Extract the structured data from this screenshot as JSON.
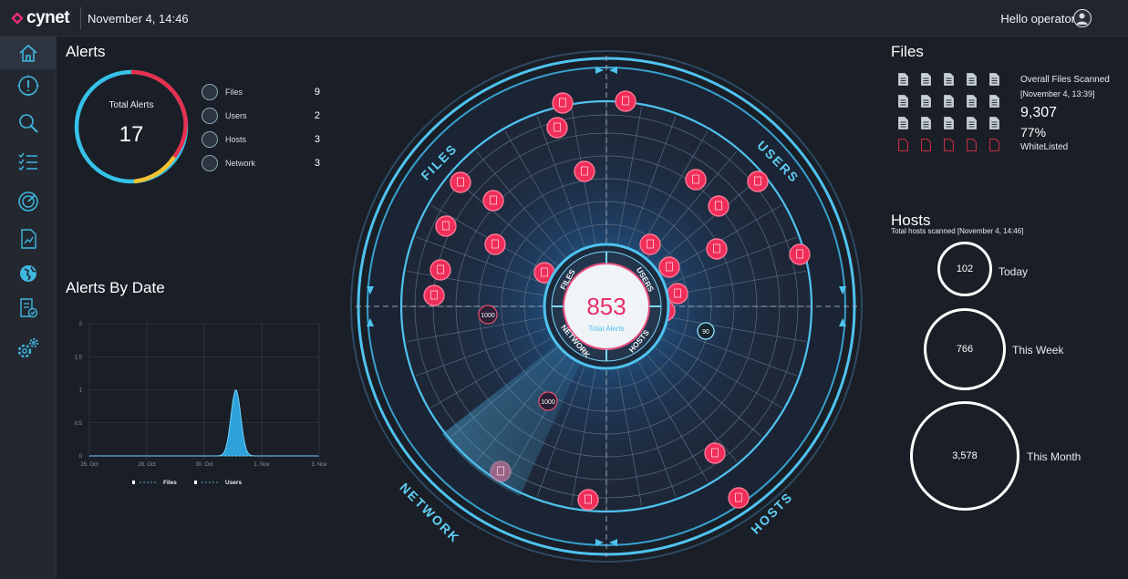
{
  "app": {
    "logo_text": "cynet",
    "date": "November 4, 14:46",
    "greeting": "Hello operator"
  },
  "sidebar": {
    "items": [
      {
        "icon": "home-icon",
        "active": true
      },
      {
        "icon": "alert-compass-icon"
      },
      {
        "icon": "search-icon"
      },
      {
        "icon": "checklist-icon"
      },
      {
        "icon": "radar-icon"
      },
      {
        "icon": "report-icon"
      },
      {
        "icon": "globe-icon"
      },
      {
        "icon": "policy-icon"
      },
      {
        "icon": "settings-icon"
      }
    ]
  },
  "alerts": {
    "title": "Alerts",
    "total_label": "Total Alerts",
    "total_value": "17",
    "ring_colors": {
      "files": "#e8304e",
      "users": "#e8304e",
      "hosts": "#f2c230",
      "network": "#36c2e8"
    },
    "categories": [
      {
        "label": "Files",
        "count": "9"
      },
      {
        "label": "Users",
        "count": "2"
      },
      {
        "label": "Hosts",
        "count": "3"
      },
      {
        "label": "Network",
        "count": "3"
      }
    ]
  },
  "alerts_by_date": {
    "title": "Alerts By Date",
    "legend": [
      "Files",
      "Users"
    ]
  },
  "chart_data": {
    "type": "area",
    "x": [
      "26. Oct",
      "28. Oct",
      "30. Oct",
      "1. Nov",
      "3. Nov"
    ],
    "ylim": [
      0,
      2
    ],
    "yticks": [
      "0",
      "0.5",
      "1",
      "1.5",
      "2"
    ],
    "series": [
      {
        "name": "Files",
        "points": [
          [
            0,
            0
          ],
          [
            2.2,
            0
          ],
          [
            2.35,
            0.3
          ],
          [
            2.55,
            1
          ],
          [
            2.75,
            0.3
          ],
          [
            2.9,
            0
          ],
          [
            4,
            0
          ]
        ]
      },
      {
        "name": "Users",
        "points": [
          [
            0,
            0
          ],
          [
            4,
            0
          ]
        ]
      }
    ],
    "grid": true,
    "legend": "bottom"
  },
  "radar": {
    "center_value": "853",
    "center_sub": "Total Alerts",
    "sectors": [
      "FILES",
      "USERS",
      "HOSTS",
      "NETWORK"
    ],
    "inner_labels": [
      "FILES",
      "USERS",
      "NETWORK",
      "HOSTS"
    ],
    "markers": [
      "1000",
      "1000",
      "90"
    ]
  },
  "files": {
    "title": "Files",
    "scanned_label": "Overall Files Scanned",
    "scanned_date": "[November 4, 13:39]",
    "scanned_value": "9,307",
    "whitelisted_pct": "77%",
    "whitelisted_label": "WhiteListed"
  },
  "hosts": {
    "title": "Hosts",
    "subtitle": "Total hosts scanned [November 4, 14:46]",
    "stats": [
      {
        "value": "102",
        "label": "Today"
      },
      {
        "value": "766",
        "label": "This Week"
      },
      {
        "value": "3,578",
        "label": "This Month"
      }
    ]
  }
}
